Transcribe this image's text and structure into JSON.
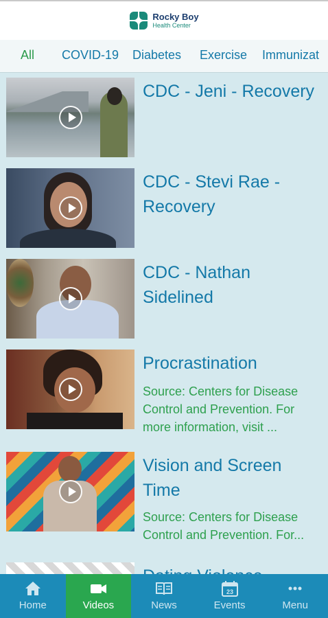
{
  "header": {
    "logo_line1": "Rocky Boy",
    "logo_line2": "Health Center"
  },
  "tabs": [
    {
      "label": "All",
      "active": true
    },
    {
      "label": "COVID-19",
      "active": false
    },
    {
      "label": "Diabetes",
      "active": false
    },
    {
      "label": "Exercise",
      "active": false
    },
    {
      "label": "Immunizat",
      "active": false
    }
  ],
  "videos": [
    {
      "title": "CDC - Jeni - Recovery",
      "source": ""
    },
    {
      "title": "CDC - Stevi Rae - Recovery",
      "source": ""
    },
    {
      "title": "CDC - Nathan Sidelined",
      "source": ""
    },
    {
      "title": "Procrastination",
      "source": "Source: Centers for Disease Control and Prevention. For more information, visit ..."
    },
    {
      "title": "Vision and Screen Time",
      "source": "Source: Centers for Disease Control and Prevention. For..."
    },
    {
      "title": "Dating Violence",
      "source": ""
    }
  ],
  "bottom_nav": [
    {
      "label": "Home",
      "icon": "home-icon",
      "active": false
    },
    {
      "label": "Videos",
      "icon": "video-camera-icon",
      "active": true
    },
    {
      "label": "News",
      "icon": "book-icon",
      "active": false
    },
    {
      "label": "Events",
      "icon": "calendar-icon",
      "calendar_day": "23",
      "active": false
    },
    {
      "label": "Menu",
      "icon": "more-icon",
      "active": false
    }
  ],
  "colors": {
    "accent_blue": "#1479a8",
    "accent_green": "#2ea04e",
    "nav_bg": "#1c8bb8",
    "list_bg": "#d5e9ee"
  }
}
